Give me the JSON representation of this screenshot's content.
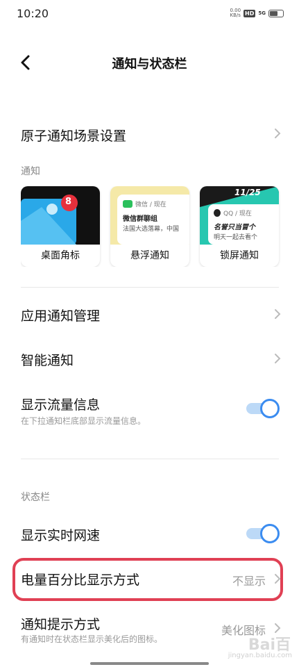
{
  "status_bar": {
    "time": "10:20",
    "speed": "0.00",
    "speed_unit": "KB/s",
    "hd": "HD",
    "network": "5G",
    "battery_level": 0.6
  },
  "header": {
    "title": "通知与状态栏"
  },
  "rows": {
    "atomic": {
      "label": "原子通知场景设置"
    },
    "app_manage": {
      "label": "应用通知管理"
    },
    "smart": {
      "label": "智能通知"
    },
    "traffic": {
      "label": "显示流量信息",
      "sub": "在下拉通知栏底部显示流量信息。",
      "on": true
    },
    "netspeed": {
      "label": "显示实时网速",
      "on": true
    },
    "battery": {
      "label": "电量百分比显示方式",
      "value": "不显示"
    },
    "notify_style": {
      "label": "通知提示方式",
      "sub": "有通知时在状态栏显示美化后的图标。",
      "value": "美化图标"
    }
  },
  "sections": {
    "notify": "通知",
    "statusbar": "状态栏"
  },
  "cards": [
    {
      "label": "桌面角标",
      "badge": "8"
    },
    {
      "label": "悬浮通知",
      "app": "微信 / 现在",
      "msg_title": "微信群聊组",
      "msg_body": "法国大选落幕，中国"
    },
    {
      "label": "锁屏通知",
      "date": "11/25",
      "app": "QQ / 现在",
      "msg_title": "名誉只当冒个",
      "msg_body": "明天一起去看个"
    }
  ],
  "watermark": {
    "text": "Bai百",
    "sub": "jingyan.baidu.com"
  }
}
